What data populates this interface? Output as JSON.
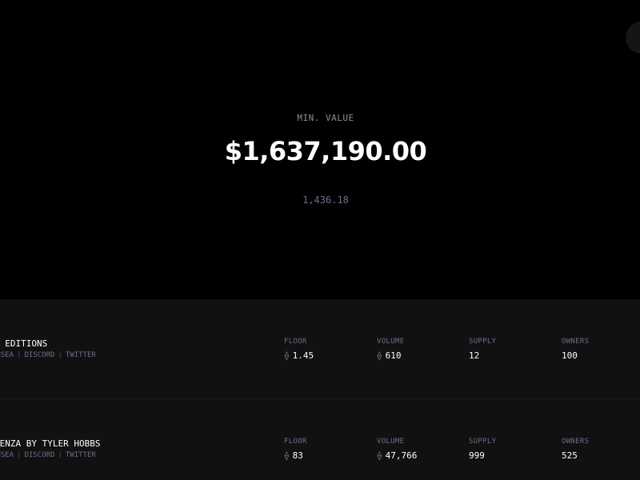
{
  "hero": {
    "label": "MIN. VALUE",
    "value": "$1,637,190.00",
    "sub": "1,436.18"
  },
  "currency_symbol": "⟠",
  "collections": [
    {
      "name": "K EDITIONS",
      "links": [
        "ENSEA",
        "DISCORD",
        "TWITTER"
      ],
      "stats": [
        {
          "label": "FLOOR",
          "value": "1.45",
          "eth": true
        },
        {
          "label": "VOLUME",
          "value": "610",
          "eth": true
        },
        {
          "label": "SUPPLY",
          "value": "12",
          "eth": false
        },
        {
          "label": "OWNERS",
          "value": "100",
          "eth": false
        }
      ]
    },
    {
      "name": "DENZA BY TYLER HOBBS",
      "links": [
        "ENSEA",
        "DISCORD",
        "TWITTER"
      ],
      "stats": [
        {
          "label": "FLOOR",
          "value": "83",
          "eth": true
        },
        {
          "label": "VOLUME",
          "value": "47,766",
          "eth": true
        },
        {
          "label": "SUPPLY",
          "value": "999",
          "eth": false
        },
        {
          "label": "OWNERS",
          "value": "525",
          "eth": false
        }
      ]
    }
  ],
  "colors": {
    "background": "#000000",
    "list_background": "#111111",
    "muted_text": "#6b7088",
    "text": "#ffffff"
  }
}
